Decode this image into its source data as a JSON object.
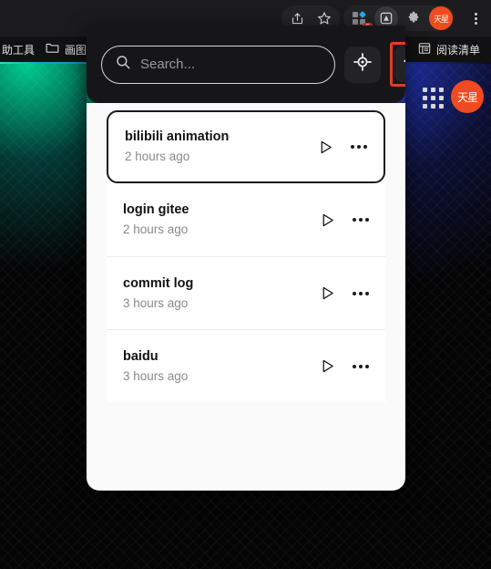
{
  "browser": {
    "toolbar": {
      "share_label": "share-icon",
      "bookmark_label": "star-icon",
      "extensions_label": "extensions-icon",
      "extension_badge_count": "6",
      "active_extension_label": "active-extension-icon",
      "puzzle_label": "puzzle-icon",
      "profile_initials": "天星",
      "menu_label": "three-dot-menu"
    },
    "bookmarks_bar": {
      "items": [
        {
          "label": "助工具",
          "icon": "none"
        },
        {
          "label": "画图",
          "icon": "folder-icon"
        }
      ],
      "reading_list": "阅读清单"
    }
  },
  "popup": {
    "search": {
      "placeholder": "Search...",
      "value": ""
    },
    "locate_button_label": "locate-target",
    "home_button_label": "home",
    "home_button_highlight_color": "#e23b26",
    "items": [
      {
        "title": "bilibili animation",
        "time": "2 hours ago",
        "selected": true
      },
      {
        "title": "login gitee",
        "time": "2 hours ago",
        "selected": false
      },
      {
        "title": "commit log",
        "time": "3 hours ago",
        "selected": false
      },
      {
        "title": "baidu",
        "time": "3 hours ago",
        "selected": false
      }
    ],
    "row_actions": {
      "play_label": "play",
      "more_label": "more-options"
    }
  },
  "page": {
    "apps_grid_label": "apps-grid",
    "avatar_initials": "天星",
    "accent_green": "#23e3b2",
    "accent_blue": "#1433b8"
  }
}
